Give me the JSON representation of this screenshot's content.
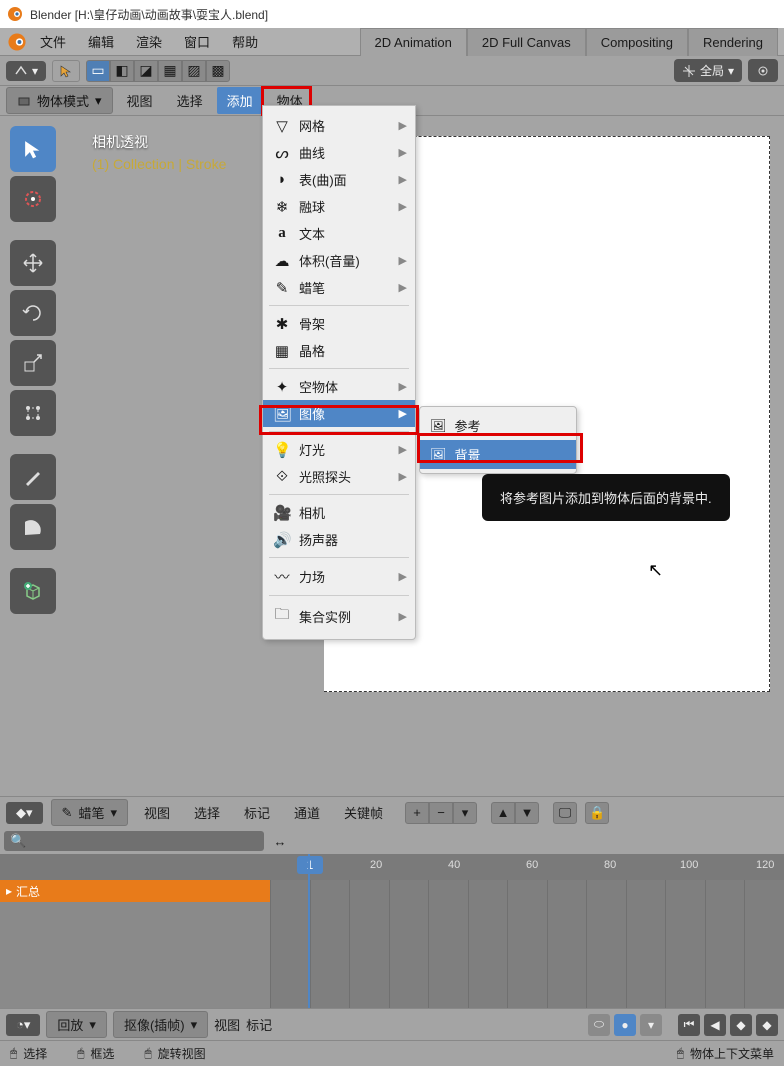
{
  "title": "Blender [H:\\皇仔动画\\动画故事\\耍宝人.blend]",
  "menu": {
    "file": "文件",
    "edit": "编辑",
    "render": "渲染",
    "window": "窗口",
    "help": "帮助"
  },
  "workspaces": {
    "anim2d": "2D Animation",
    "fullcanvas": "2D Full Canvas",
    "compositing": "Compositing",
    "rendering": "Rendering"
  },
  "orientation": {
    "label": "全局"
  },
  "mode": {
    "label": "物体模式"
  },
  "header": {
    "view": "视图",
    "select": "选择",
    "add": "添加",
    "object": "物体"
  },
  "overlay": {
    "camera": "相机透视",
    "collection": "(1) Collection | Stroke"
  },
  "add_menu": {
    "mesh": "网格",
    "curve": "曲线",
    "surface": "表(曲)面",
    "metaball": "融球",
    "text": "文本",
    "volume": "体积(音量)",
    "gpencil": "蜡笔",
    "armature": "骨架",
    "lattice": "晶格",
    "empty": "空物体",
    "image": "图像",
    "light": "灯光",
    "lightprobe": "光照探头",
    "camera": "相机",
    "speaker": "扬声器",
    "forcefield": "力场",
    "collection_instance": "集合实例"
  },
  "image_submenu": {
    "reference": "参考",
    "background": "背景"
  },
  "tooltip": "将参考图片添加到物体后面的背景中.",
  "timeline": {
    "mode": "蜡笔",
    "view": "视图",
    "select": "选择",
    "marker": "标记",
    "channel": "通道",
    "keyframe": "关键帧",
    "summary": "汇总",
    "current_frame": "1",
    "ticks": [
      "20",
      "40",
      "60",
      "80",
      "100",
      "120"
    ]
  },
  "playback": {
    "playback": "回放",
    "keying": "抠像(插帧)",
    "view": "视图",
    "marker": "标记"
  },
  "status": {
    "select": "选择",
    "box": "框选",
    "rotate": "旋转视图",
    "context": "物体上下文菜单"
  }
}
